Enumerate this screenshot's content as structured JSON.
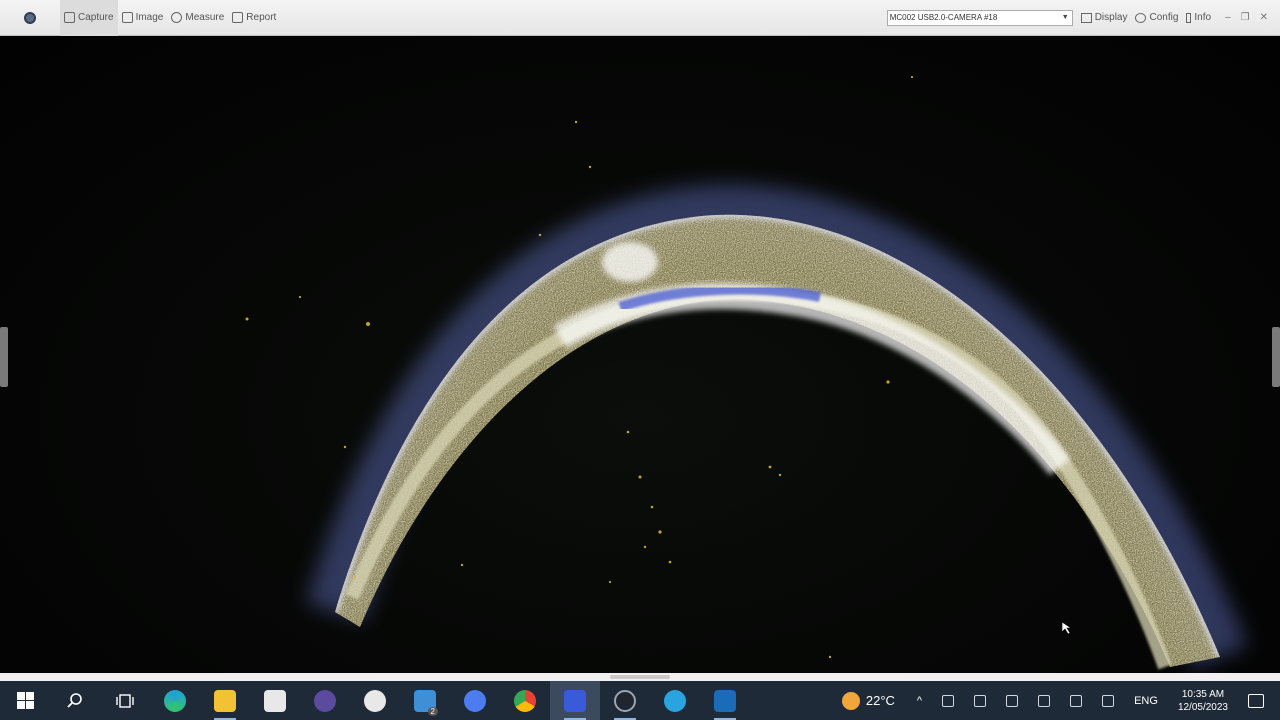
{
  "toolbar": {
    "tools": [
      {
        "label": "Capture",
        "icon": "capture-icon",
        "active": true
      },
      {
        "label": "Image",
        "icon": "image-icon",
        "active": false
      },
      {
        "label": "Measure",
        "icon": "measure-icon",
        "active": false
      },
      {
        "label": "Report",
        "icon": "report-icon",
        "active": false
      }
    ],
    "camera_select": "MC002 USB2.0-CAMERA #18",
    "right_tools": [
      {
        "label": "Display",
        "icon": "monitor-icon"
      },
      {
        "label": "Config",
        "icon": "gear-icon"
      },
      {
        "label": "Info",
        "icon": "info-icon"
      }
    ],
    "window_controls": [
      "–",
      "❐",
      "✕"
    ]
  },
  "viewport": {
    "content": "microscope-live-view",
    "colors": {
      "glow": "#c9d6ff",
      "specimen": "#bdb37a",
      "background": "#050605"
    }
  },
  "taskbar": {
    "apps": [
      {
        "name": "search-icon"
      },
      {
        "name": "task-view-icon"
      },
      {
        "name": "edge-icon",
        "color": "#1ea0dc"
      },
      {
        "name": "file-explorer-icon",
        "color": "#f3c234"
      },
      {
        "name": "store-icon",
        "color": "#e8e8e8"
      },
      {
        "name": "vlc-icon",
        "color": "#5b4a9e"
      },
      {
        "name": "zoom-icon",
        "color": "#e8e8e8"
      },
      {
        "name": "mail-icon",
        "color": "#3f8fd6",
        "badge": "2"
      },
      {
        "name": "chat-icon",
        "color": "#4d7cf0"
      },
      {
        "name": "chrome-icon",
        "color": "#e94235"
      },
      {
        "name": "microscope-app-icon",
        "color": "#3a5bd9"
      },
      {
        "name": "camera-app-icon",
        "color": "#20262f"
      },
      {
        "name": "telegram-icon",
        "color": "#2aa4de"
      },
      {
        "name": "photos-icon",
        "color": "#1a6bb8"
      }
    ],
    "weather": {
      "temp": "22°C"
    },
    "language": "ENG",
    "time": "10:35 AM",
    "date": "12/05/2023"
  }
}
